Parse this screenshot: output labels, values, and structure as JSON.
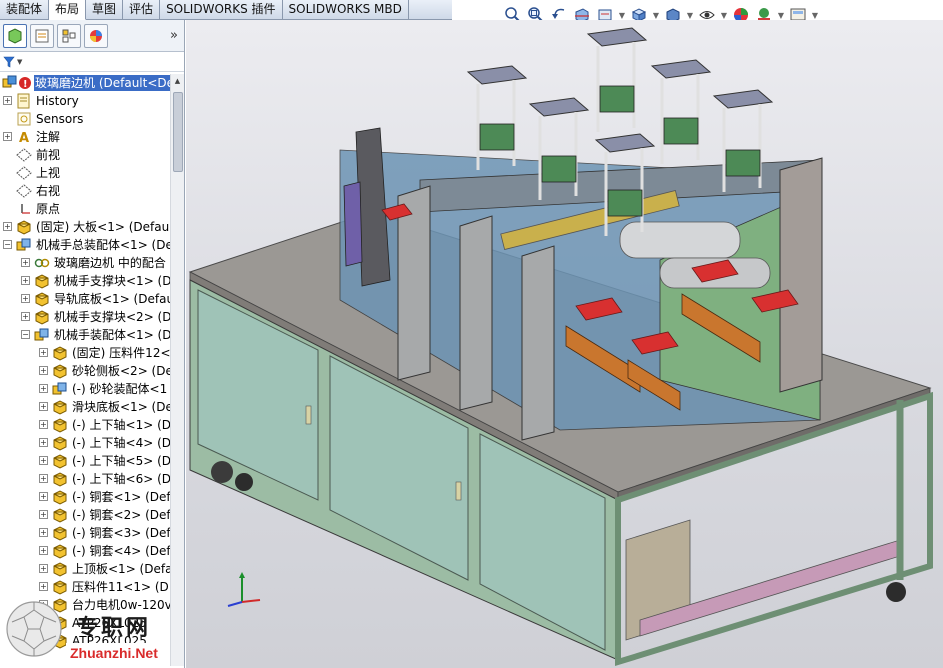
{
  "tabs": [
    {
      "label": "装配体",
      "active": false
    },
    {
      "label": "布局",
      "active": true
    },
    {
      "label": "草图",
      "active": false
    },
    {
      "label": "评估",
      "active": false
    },
    {
      "label": "SOLIDWORKS 插件",
      "active": false
    },
    {
      "label": "SOLIDWORKS MBD",
      "active": false
    }
  ],
  "view_toolbar": [
    "zoom-to-fit-icon",
    "zoom-area-icon",
    "previous-view-icon",
    "section-view-icon",
    "dynamic-annotation-icon",
    "view-orientation-icon",
    "display-style-icon",
    "hide-show-icon",
    "edit-appearance-icon",
    "apply-scene-icon",
    "view-settings-icon"
  ],
  "panel_tabs": [
    "featuremanager-icon",
    "propertymanager-icon",
    "configurationmanager-icon",
    "displaymanager-icon"
  ],
  "panel_more": "»",
  "tree": [
    {
      "level": 0,
      "exp": "",
      "icon": "assembly-icon",
      "label": "玻璃磨边机  (Default<De",
      "selected": true
    },
    {
      "level": 1,
      "exp": "+",
      "icon": "history-icon",
      "label": "History"
    },
    {
      "level": 1,
      "exp": "",
      "icon": "sensors-icon",
      "label": "Sensors"
    },
    {
      "level": 1,
      "exp": "+",
      "icon": "annotations-icon",
      "label": "注解"
    },
    {
      "level": 1,
      "exp": "",
      "icon": "plane-icon",
      "label": "前视"
    },
    {
      "level": 1,
      "exp": "",
      "icon": "plane-icon",
      "label": "上视"
    },
    {
      "level": 1,
      "exp": "",
      "icon": "plane-icon",
      "label": "右视"
    },
    {
      "level": 1,
      "exp": "",
      "icon": "origin-icon",
      "label": "原点"
    },
    {
      "level": 1,
      "exp": "+",
      "icon": "part-icon",
      "label": "(固定) 大板<1> (Default"
    },
    {
      "level": 1,
      "exp": "−",
      "icon": "subassembly-icon",
      "label": "机械手总装配体<1> (De"
    },
    {
      "level": 2,
      "exp": "+",
      "icon": "mates-icon",
      "label": "玻璃磨边机 中的配合"
    },
    {
      "level": 2,
      "exp": "+",
      "icon": "part-icon",
      "label": "机械手支撑块<1> (D"
    },
    {
      "level": 2,
      "exp": "+",
      "icon": "part-icon",
      "label": "导轨底板<1> (Defau"
    },
    {
      "level": 2,
      "exp": "+",
      "icon": "part-icon",
      "label": "机械手支撑块<2> (D"
    },
    {
      "level": 2,
      "exp": "−",
      "icon": "subassembly-icon",
      "label": "机械手装配体<1> (D"
    },
    {
      "level": 3,
      "exp": "+",
      "icon": "part-icon",
      "label": "(固定) 压料件12<"
    },
    {
      "level": 3,
      "exp": "+",
      "icon": "part-icon",
      "label": "砂轮侧板<2> (De"
    },
    {
      "level": 3,
      "exp": "+",
      "icon": "subassembly-icon",
      "label": "(-) 砂轮装配体<1"
    },
    {
      "level": 3,
      "exp": "+",
      "icon": "part-icon",
      "label": "滑块底板<1> (De"
    },
    {
      "level": 3,
      "exp": "+",
      "icon": "part-icon",
      "label": "(-) 上下轴<1> (D"
    },
    {
      "level": 3,
      "exp": "+",
      "icon": "part-icon",
      "label": "(-) 上下轴<4> (D"
    },
    {
      "level": 3,
      "exp": "+",
      "icon": "part-icon",
      "label": "(-) 上下轴<5> (D"
    },
    {
      "level": 3,
      "exp": "+",
      "icon": "part-icon",
      "label": "(-) 上下轴<6> (D"
    },
    {
      "level": 3,
      "exp": "+",
      "icon": "part-icon",
      "label": "(-) 铜套<1> (Def"
    },
    {
      "level": 3,
      "exp": "+",
      "icon": "part-icon",
      "label": "(-) 铜套<2> (Def"
    },
    {
      "level": 3,
      "exp": "+",
      "icon": "part-icon",
      "label": "(-) 铜套<3> (Def"
    },
    {
      "level": 3,
      "exp": "+",
      "icon": "part-icon",
      "label": "(-) 铜套<4> (Def"
    },
    {
      "level": 3,
      "exp": "+",
      "icon": "part-icon",
      "label": "上顶板<1> (Defa"
    },
    {
      "level": 3,
      "exp": "+",
      "icon": "part-icon",
      "label": "压料件11<1> (D"
    },
    {
      "level": 3,
      "exp": "+",
      "icon": "part-icon",
      "label": "台力电机0w-120v"
    },
    {
      "level": 3,
      "exp": "+",
      "icon": "part-icon",
      "label": "ATP26XL025"
    },
    {
      "level": 3,
      "exp": "+",
      "icon": "part-icon",
      "label": "ATP26XL025"
    }
  ],
  "watermark": {
    "chars": "专职网",
    "url": "Zhuanzhi.Net"
  },
  "colors": {
    "selection": "#3a6cc6",
    "table": "#9a9590",
    "frame": "#9fbf9f",
    "cabinet": "#a9c8b9",
    "clamp": "#d83030"
  }
}
